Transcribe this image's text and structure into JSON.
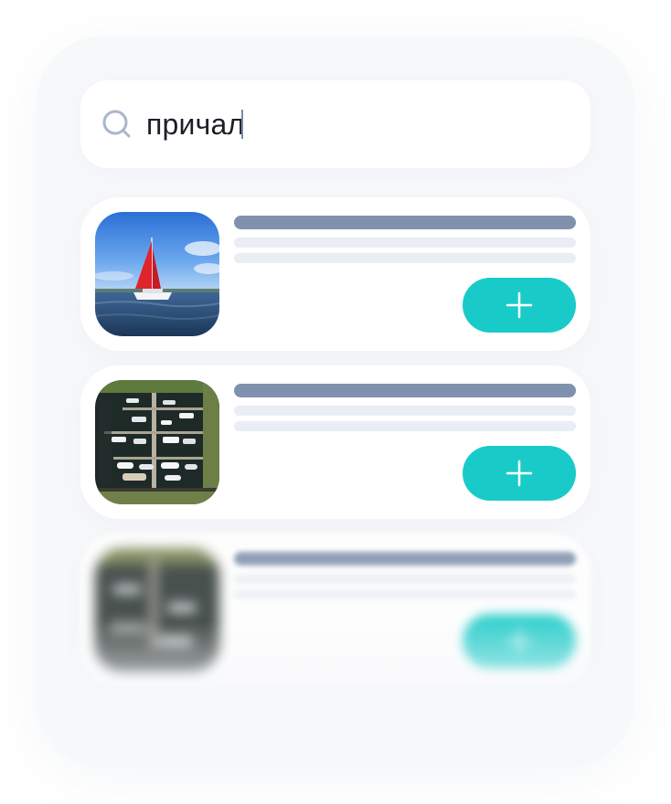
{
  "search": {
    "value": "причал",
    "icon": "search-icon"
  },
  "results": [
    {
      "thumbnail": "sailboat-photo",
      "add_icon": "plus-icon"
    },
    {
      "thumbnail": "marina-aerial-photo",
      "add_icon": "plus-icon"
    },
    {
      "thumbnail": "marina-aerial-photo",
      "add_icon": "plus-icon"
    }
  ],
  "colors": {
    "accent": "#19cbc8",
    "title_placeholder": "#8091ad",
    "subtitle_placeholder": "#e9edf4",
    "text": "#1c1f26"
  }
}
